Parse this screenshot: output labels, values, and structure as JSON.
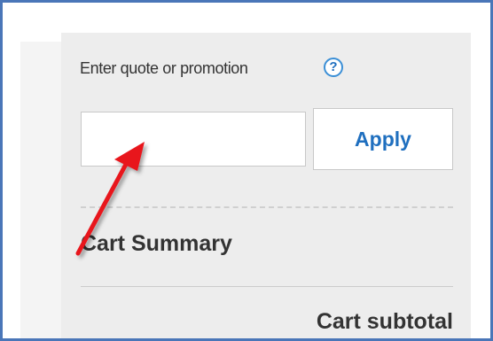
{
  "promo": {
    "label": "Enter quote or promotion",
    "help_icon": "question-mark-icon",
    "help_glyph": "?",
    "input_value": "",
    "input_placeholder": "",
    "apply_label": "Apply"
  },
  "cart": {
    "summary_title": "Cart Summary",
    "subtotal_label": "Cart subtotal"
  },
  "colors": {
    "frame_border": "#4a76b8",
    "panel_background": "#ededed",
    "accent_blue": "#1f6fbf",
    "annotation_arrow": "#e8141b"
  },
  "annotation": {
    "icon": "red-arrow-icon"
  }
}
